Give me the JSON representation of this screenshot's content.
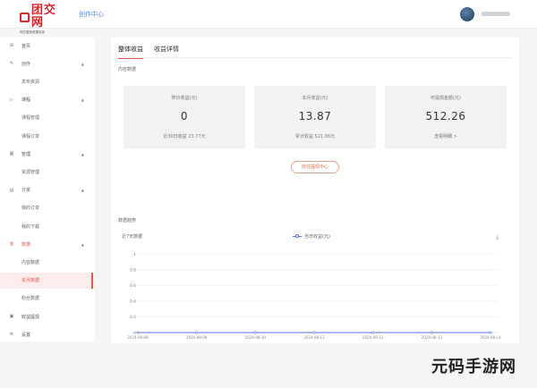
{
  "header": {
    "logo_text": "团交网",
    "logo_sub": "网交虚拟资源买卖",
    "creator_center": "创作中心"
  },
  "sidebar": {
    "items": [
      {
        "label": "首页",
        "icon": "home-icon",
        "glyph": "⊞"
      },
      {
        "label": "创作",
        "icon": "edit-icon",
        "glyph": "✎",
        "caret": "▲"
      },
      {
        "label": "发布资源",
        "sub": true
      },
      {
        "label": "课程",
        "icon": "video-icon",
        "glyph": "▷",
        "caret": "▲"
      },
      {
        "label": "课程管理",
        "sub": true
      },
      {
        "label": "课程订单",
        "sub": true
      },
      {
        "label": "管理",
        "icon": "grid-icon",
        "glyph": "▦",
        "caret": "▲"
      },
      {
        "label": "资源管理",
        "sub": true
      },
      {
        "label": "订单",
        "icon": "order-icon",
        "glyph": "▤",
        "caret": "▲"
      },
      {
        "label": "我的订单",
        "sub": true
      },
      {
        "label": "我的下载",
        "sub": true
      },
      {
        "label": "数据",
        "icon": "chart-icon",
        "glyph": "▥",
        "caret": "▲"
      },
      {
        "label": "内容数据",
        "sub": true
      },
      {
        "label": "本月数据",
        "sub": true
      },
      {
        "label": "粉丝数据",
        "sub": true
      },
      {
        "label": "收益提现",
        "icon": "wallet-icon",
        "glyph": "▣"
      },
      {
        "label": "设置",
        "icon": "gear-icon",
        "glyph": "⚙"
      }
    ]
  },
  "main": {
    "tabs": [
      "整体收益",
      "收益详情"
    ],
    "content_label": "内容数据",
    "cards": [
      {
        "title": "昨日收益(元)",
        "value": "0",
        "foot": "近30日收益 23.77元"
      },
      {
        "title": "本月收益(元)",
        "value": "13.87",
        "foot": "累计收益 521.06元"
      },
      {
        "title": "可提现金额(元)",
        "value": "512.26",
        "foot": "查看明细 >"
      }
    ],
    "center_button": "前往提现中心",
    "trend_label": "数据趋势",
    "range_label": "近7天数据",
    "legend": "当日收益(元)"
  },
  "chart_data": {
    "type": "line",
    "x": [
      "2024-08-08",
      "2024-08-09",
      "2024-08-10",
      "2024-08-11",
      "2024-08-12",
      "2024-08-13",
      "2024-08-14"
    ],
    "series": [
      {
        "name": "当日收益(元)",
        "values": [
          0,
          0,
          0,
          0,
          0,
          0,
          0
        ]
      }
    ],
    "ylim": [
      0,
      1
    ],
    "yticks": [
      "0",
      "0.2",
      "0.4",
      "0.6",
      "0.8",
      "1"
    ],
    "grid": true,
    "color": "#5a6ee0"
  },
  "watermark": "元码手游网",
  "colors": {
    "accent": "#e05a4f",
    "link": "#4a8cff"
  }
}
